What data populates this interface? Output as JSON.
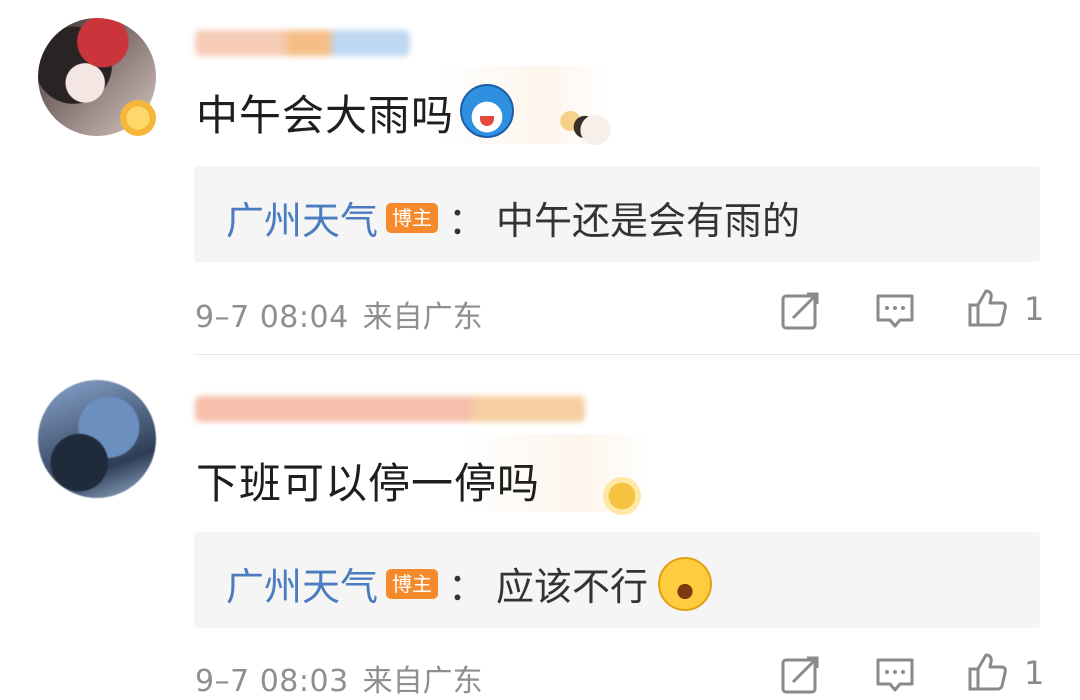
{
  "comments": [
    {
      "text": "中午会大雨吗",
      "emoji_icon": "doraemon-emoji-icon",
      "reply": {
        "author": "广州天气",
        "badge": "博主",
        "separator": "：",
        "text": "中午还是会有雨的"
      },
      "time": "9–7 08:04",
      "location": "来自广东",
      "likes": "1"
    },
    {
      "text": "下班可以停一停吗",
      "reply": {
        "author": "广州天气",
        "badge": "博主",
        "separator": "：",
        "text": "应该不行",
        "emoji_icon": "laughing-crying-emoji-icon"
      },
      "time": "9–7 08:03",
      "location": "来自广东",
      "likes": "1"
    }
  ],
  "colors": {
    "reply_name": "#4b7cc0",
    "badge_bg": "#f58a2c",
    "reply_bg": "#f5f5f5",
    "meta": "#8f8f8f"
  }
}
